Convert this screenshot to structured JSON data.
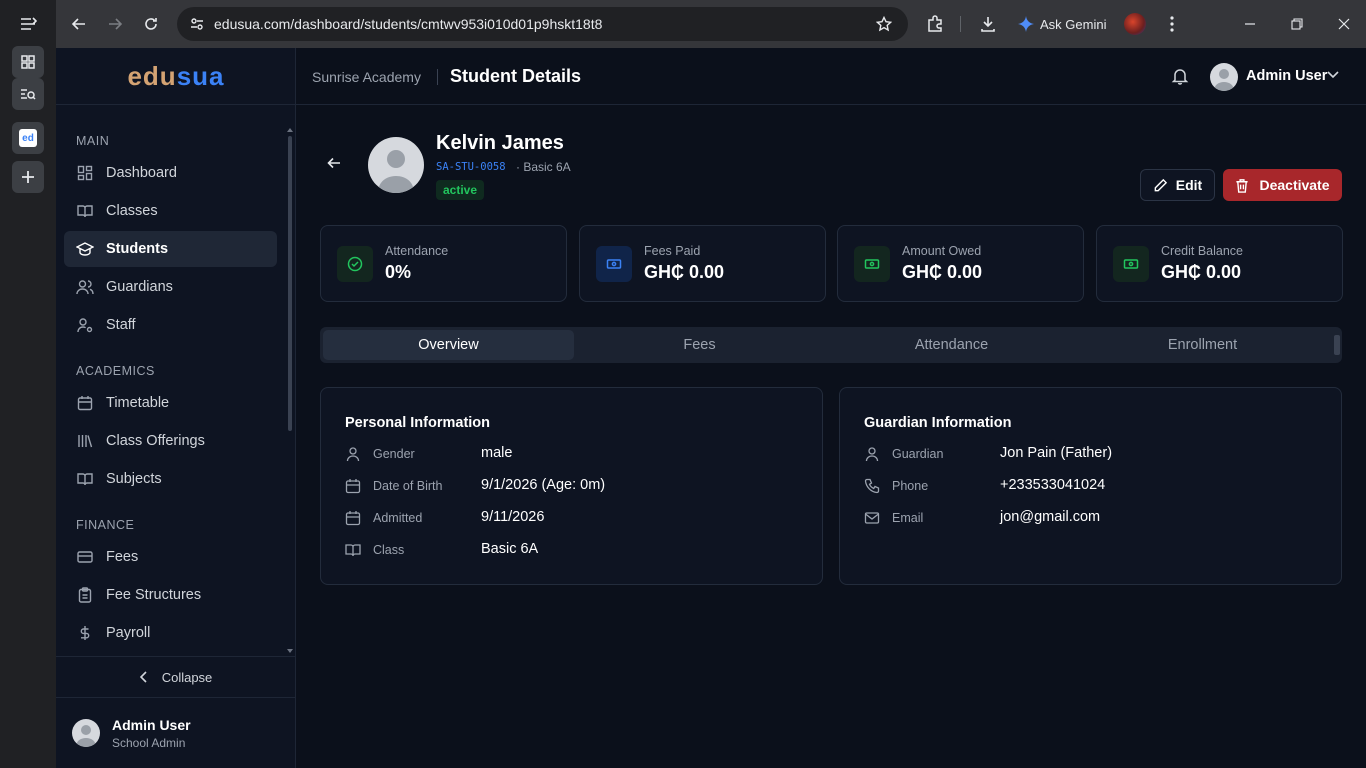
{
  "browser": {
    "url": "edusua.com/dashboard/students/cmtwv953i010d01p9hskt18t8",
    "gemini_label": "Ask Gemini"
  },
  "brand": {
    "part1": "edu",
    "part2": "sua"
  },
  "sidebar": {
    "sections": [
      {
        "label": "MAIN",
        "items": [
          "Dashboard",
          "Classes",
          "Students",
          "Guardians",
          "Staff"
        ]
      },
      {
        "label": "ACADEMICS",
        "items": [
          "Timetable",
          "Class Offerings",
          "Subjects"
        ]
      },
      {
        "label": "FINANCE",
        "items": [
          "Fees",
          "Fee Structures",
          "Payroll"
        ]
      }
    ],
    "active_item": "Students",
    "collapse_label": "Collapse",
    "user": {
      "name": "Admin User",
      "role": "School Admin"
    }
  },
  "header": {
    "school": "Sunrise Academy",
    "title": "Student Details",
    "user": "Admin User"
  },
  "student": {
    "name": "Kelvin James",
    "id": "SA-STU-0058",
    "class_line": "· Basic 6A",
    "status": "active"
  },
  "actions": {
    "edit": "Edit",
    "deactivate": "Deactivate"
  },
  "stats": [
    {
      "label": "Attendance",
      "value": "0%"
    },
    {
      "label": "Fees Paid",
      "value": "GH₵ 0.00"
    },
    {
      "label": "Amount Owed",
      "value": "GH₵ 0.00"
    },
    {
      "label": "Credit Balance",
      "value": "GH₵ 0.00"
    }
  ],
  "tabs": [
    "Overview",
    "Fees",
    "Attendance",
    "Enrollment"
  ],
  "active_tab": "Overview",
  "personal": {
    "title": "Personal Information",
    "rows": [
      {
        "label": "Gender",
        "value": "male"
      },
      {
        "label": "Date of Birth",
        "value": "9/1/2026 (Age: 0m)"
      },
      {
        "label": "Admitted",
        "value": "9/11/2026"
      },
      {
        "label": "Class",
        "value": "Basic 6A"
      }
    ]
  },
  "guardian": {
    "title": "Guardian Information",
    "rows": [
      {
        "label": "Guardian",
        "value": "Jon Pain (Father)"
      },
      {
        "label": "Phone",
        "value": "+233533041024"
      },
      {
        "label": "Email",
        "value": "jon@gmail.com"
      }
    ]
  },
  "colors": {
    "accent": "#3b82f6",
    "danger": "#a8272b",
    "success": "#22c55e",
    "brand_gold": "#d4a373"
  }
}
